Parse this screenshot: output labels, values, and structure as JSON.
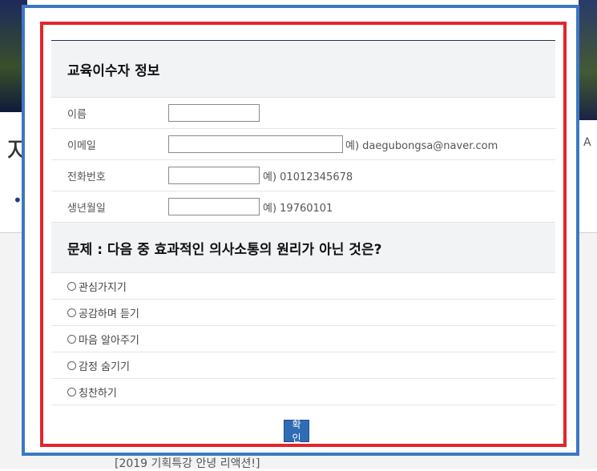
{
  "background": {
    "left_glyph": "지",
    "left_dot": "•",
    "right_glyph": "A",
    "bottom_text": "[2019 기획특강 안녕 리액션!]"
  },
  "form": {
    "section_title": "교육이수자 정보",
    "fields": [
      {
        "label": "이름",
        "value": "",
        "hint": ""
      },
      {
        "label": "이메일",
        "value": "",
        "hint": "예) daegubongsa@naver.com"
      },
      {
        "label": "전화번호",
        "value": "",
        "hint": "예) 01012345678"
      },
      {
        "label": "생년월일",
        "value": "",
        "hint": "예) 19760101"
      }
    ]
  },
  "quiz": {
    "question": "문제 : 다음 중 효과적인 의사소통의 원리가 아닌 것은?",
    "options": [
      "관심가지기",
      "공감하며 듣기",
      "마음 알아주기",
      "감정 숨기기",
      "칭찬하기"
    ]
  },
  "confirm_label": "확인",
  "colors": {
    "outer_frame": "#3b78c4",
    "inner_frame": "#e3262b",
    "button": "#2f6cb5",
    "section_bg": "#f2f3f5"
  }
}
